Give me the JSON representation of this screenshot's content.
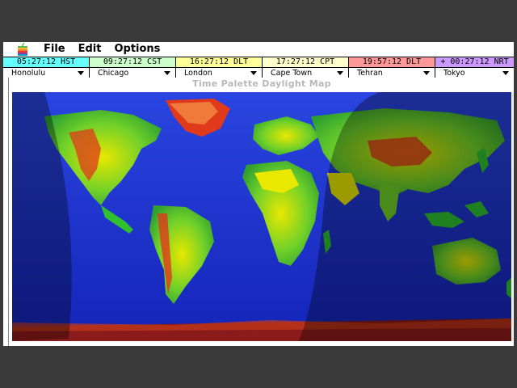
{
  "menubar": {
    "apple_icon": "apple-logo-icon",
    "items": [
      "File",
      "Edit",
      "Options"
    ]
  },
  "clocks": [
    {
      "time": "05:27:12 HST",
      "city": "Honolulu",
      "color": "#66ffff"
    },
    {
      "time": "09:27:12 CST",
      "city": "Chicago",
      "color": "#ccffcc"
    },
    {
      "time": "16:27:12 DLT",
      "city": "London",
      "color": "#ffff99"
    },
    {
      "time": "17:27:12 CPT",
      "city": "Cape Town",
      "color": "#ffffcc"
    },
    {
      "time": "19:57:12 DLT",
      "city": "Tehran",
      "color": "#ff9999"
    },
    {
      "time": "+ 00:27:12 NRT",
      "city": "Tokyo",
      "color": "#cc99ff"
    }
  ],
  "map": {
    "title": "Time Palette Daylight Map"
  },
  "colors": {
    "ocean": "#1a2fd0",
    "land_low": "#2fbf2f",
    "land_mid": "#e8e800",
    "land_high": "#e03a1a",
    "ice": "#8b1a1a",
    "night_overlay": "#000000"
  }
}
